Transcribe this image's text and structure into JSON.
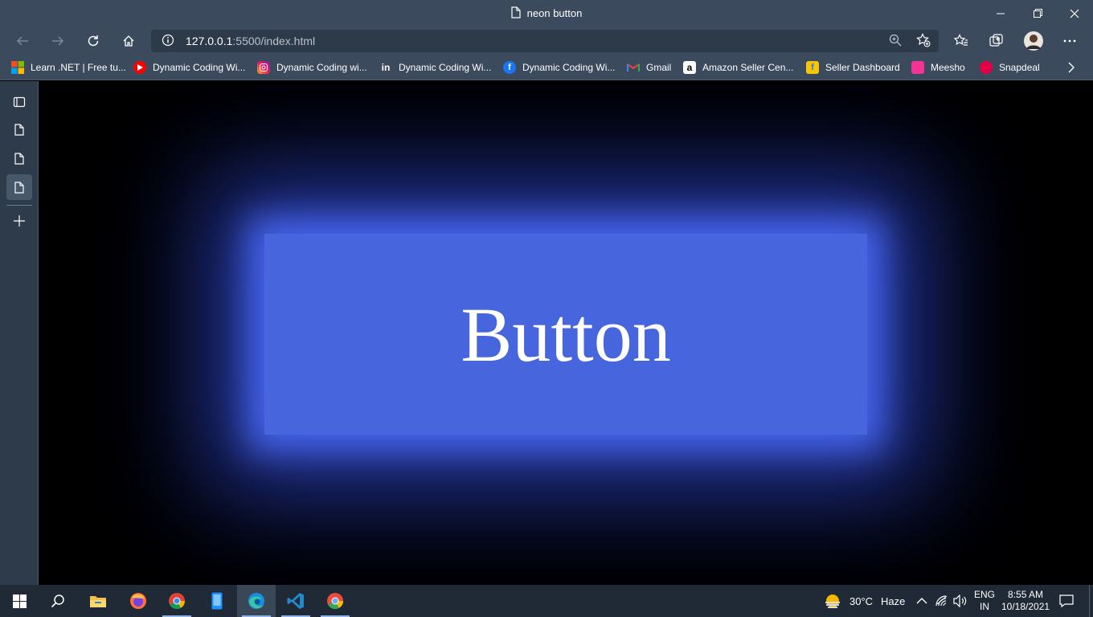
{
  "window": {
    "title": "neon button",
    "controls": [
      "minimize-icon",
      "restore-icon",
      "close-icon"
    ]
  },
  "toolbar": {
    "url_host": "127.0.0.1",
    "url_path": ":5500/index.html"
  },
  "favorites": [
    {
      "label": "Learn .NET | Free tu...",
      "icon": "microsoft-icon"
    },
    {
      "label": "Dynamic Coding Wi...",
      "icon": "youtube-icon"
    },
    {
      "label": "Dynamic Coding wi...",
      "icon": "instagram-icon"
    },
    {
      "label": "Dynamic Coding Wi...",
      "icon": "linkedin-icon"
    },
    {
      "label": "Dynamic Coding Wi...",
      "icon": "facebook-icon"
    },
    {
      "label": "Gmail",
      "icon": "gmail-icon"
    },
    {
      "label": "Amazon Seller Cen...",
      "icon": "amazon-icon"
    },
    {
      "label": "Seller Dashboard",
      "icon": "flipkart-icon"
    },
    {
      "label": "Meesho",
      "icon": "meesho-icon"
    },
    {
      "label": "Snapdeal",
      "icon": "snapdeal-icon"
    }
  ],
  "page": {
    "button_label": "Button",
    "button_color": "#4766dd",
    "background": "#000000"
  },
  "taskbar": {
    "apps": [
      "start-icon",
      "search-icon",
      "file-explorer-icon",
      "firefox-icon",
      "chrome-icon",
      "phone-app-icon",
      "edge-icon",
      "vscode-icon",
      "chrome-canary-icon"
    ],
    "weather_temp": "30°C",
    "weather_desc": "Haze",
    "lang_top": "ENG",
    "lang_bottom": "IN",
    "time": "8:55 AM",
    "date": "10/18/2021"
  }
}
